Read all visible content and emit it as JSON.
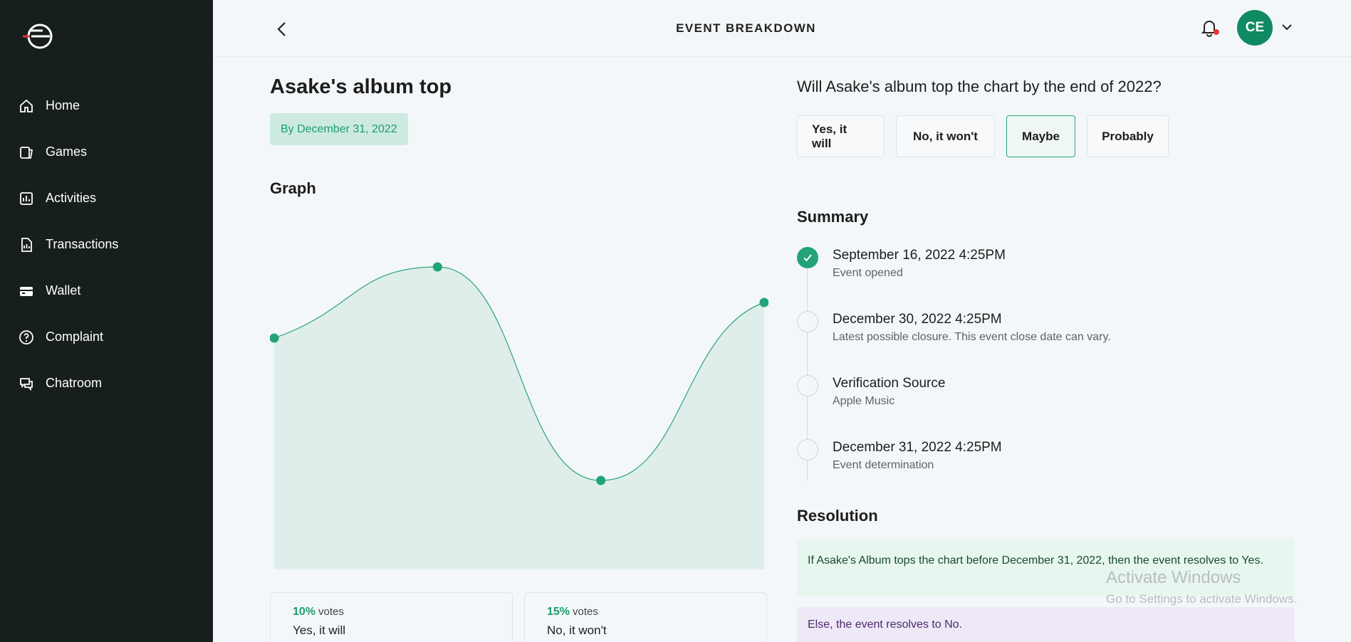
{
  "app": {
    "logo_icon": "brand-logo-icon"
  },
  "sidebar": {
    "items": [
      {
        "label": "Home",
        "icon": "home-icon"
      },
      {
        "label": "Games",
        "icon": "games-icon"
      },
      {
        "label": "Activities",
        "icon": "activities-icon"
      },
      {
        "label": "Transactions",
        "icon": "transactions-icon"
      },
      {
        "label": "Wallet",
        "icon": "wallet-icon"
      },
      {
        "label": "Complaint",
        "icon": "complaint-icon"
      },
      {
        "label": "Chatroom",
        "icon": "chatroom-icon"
      }
    ]
  },
  "header": {
    "title": "EVENT BREAKDOWN",
    "avatar_initials": "CE"
  },
  "event": {
    "title": "Asake's album top",
    "deadline": "By December 31, 2022",
    "graph_title": "Graph"
  },
  "chart_data": {
    "type": "area",
    "x": [
      1,
      2,
      3,
      4
    ],
    "values": [
      65,
      85,
      25,
      75
    ],
    "ylim": [
      0,
      100
    ],
    "colors": {
      "line": "#2aa57a",
      "fill": "#dfeeea",
      "point": "#22a37a"
    }
  },
  "votes": [
    {
      "percent": "10%",
      "votes_label": "votes",
      "option": "Yes, it will"
    },
    {
      "percent": "15%",
      "votes_label": "votes",
      "option": "No, it won't"
    }
  ],
  "question": {
    "text": "Will Asake's album top the chart by the end of 2022?",
    "choices": [
      "Yes, it will",
      "No, it won't",
      "Maybe",
      "Probably"
    ],
    "selected": "Maybe"
  },
  "summary": {
    "title": "Summary",
    "items": [
      {
        "heading": "September 16, 2022 4:25PM",
        "sub": "Event opened",
        "done": true
      },
      {
        "heading": "December 30, 2022 4:25PM",
        "sub": "Latest possible closure. This event close date can vary.",
        "done": false
      },
      {
        "heading": "Verification Source",
        "sub": "Apple Music",
        "done": false
      },
      {
        "heading": "December 31, 2022 4:25PM",
        "sub": "Event determination",
        "done": false
      }
    ]
  },
  "resolution": {
    "title": "Resolution",
    "yes_text": "If Asake's Album tops the chart before December 31, 2022, then the event resolves to Yes.",
    "no_text": "Else, the event resolves to No."
  },
  "watermark": {
    "line1": "Activate Windows",
    "line2": "Go to Settings to activate Windows."
  }
}
